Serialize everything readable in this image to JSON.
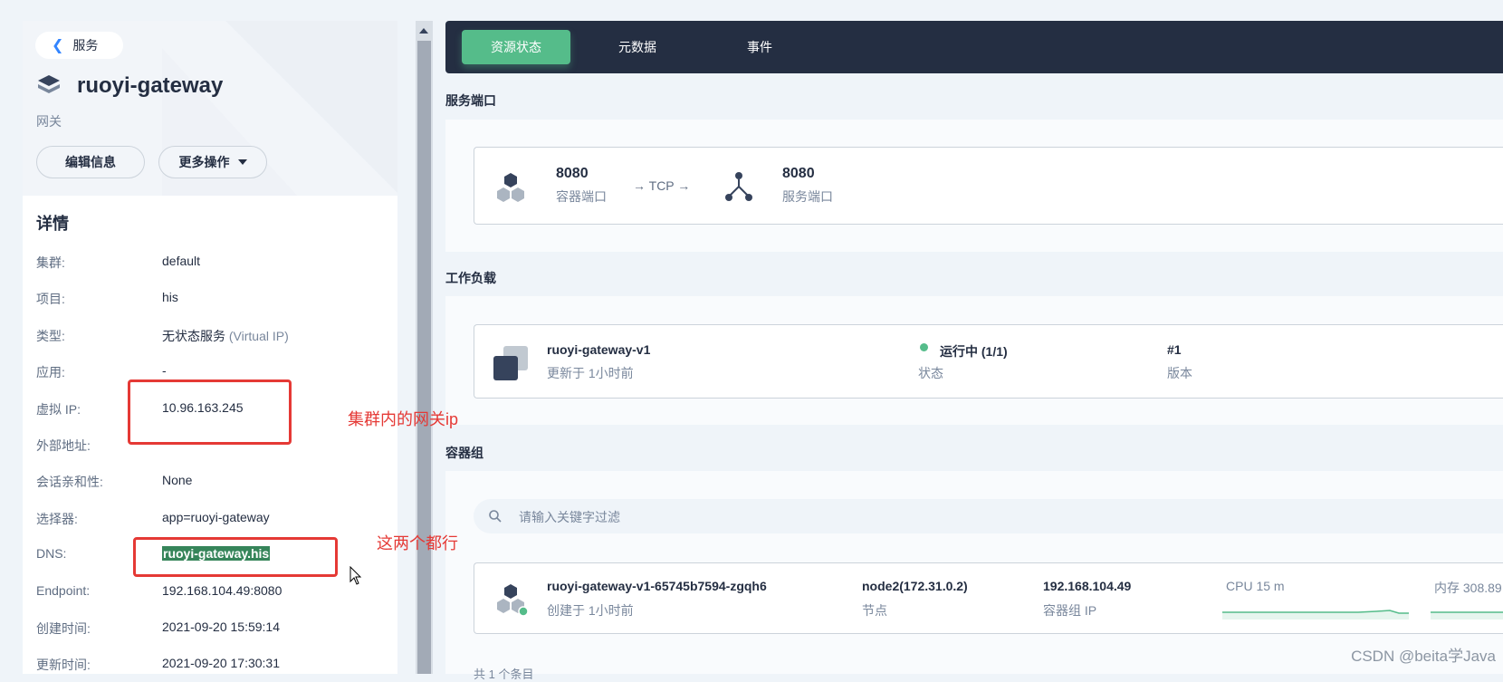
{
  "left": {
    "back_label": "服务",
    "service_name": "ruoyi-gateway",
    "service_alias": "网关",
    "edit_button": "编辑信息",
    "more_button": "更多操作",
    "details_title": "详情",
    "details": [
      {
        "key": "集群:",
        "value": "default",
        "extra": ""
      },
      {
        "key": "项目:",
        "value": "his",
        "extra": ""
      },
      {
        "key": "类型:",
        "value": "无状态服务",
        "extra": "(Virtual IP)"
      },
      {
        "key": "应用:",
        "value": "-",
        "extra": ""
      },
      {
        "key": "虚拟 IP:",
        "value": "10.96.163.245",
        "extra": ""
      },
      {
        "key": "外部地址:",
        "value": "",
        "extra": ""
      },
      {
        "key": "会话亲和性:",
        "value": "None",
        "extra": ""
      },
      {
        "key": "选择器:",
        "value": "app=ruoyi-gateway",
        "extra": ""
      },
      {
        "key": "DNS:",
        "value": "ruoyi-gateway.his",
        "extra": ""
      },
      {
        "key": "Endpoint:",
        "value": "192.168.104.49:8080",
        "extra": ""
      },
      {
        "key": "创建时间:",
        "value": "2021-09-20 15:59:14",
        "extra": ""
      },
      {
        "key": "更新时间:",
        "value": "2021-09-20 17:30:31",
        "extra": ""
      }
    ]
  },
  "tabs": [
    {
      "label": "资源状态",
      "active": true
    },
    {
      "label": "元数据",
      "active": false
    },
    {
      "label": "事件",
      "active": false
    }
  ],
  "ports": {
    "title": "服务端口",
    "container_port": "8080",
    "container_port_label": "容器端口",
    "protocol": "→ TCP →",
    "service_port": "8080",
    "service_port_label": "服务端口"
  },
  "workload": {
    "title": "工作负载",
    "name": "ruoyi-gateway-v1",
    "updated": "更新于 1小时前",
    "status": "运行中 (1/1)",
    "status_label": "状态",
    "version": "#1",
    "version_label": "版本"
  },
  "pods": {
    "title": "容器组",
    "search_placeholder": "请输入关键字过滤",
    "pod_name": "ruoyi-gateway-v1-65745b7594-zgqh6",
    "created": "创建于 1小时前",
    "node": "node2(172.31.0.2)",
    "node_label": "节点",
    "pod_ip": "192.168.104.49",
    "pod_ip_label": "容器组 IP",
    "cpu": "CPU 15 m",
    "memory": "内存 308.89",
    "footer": "共 1 个条目"
  },
  "annotations": {
    "ip_note": "集群内的网关ip",
    "dns_note": "这两个都行"
  },
  "watermark": "CSDN @beita学Java",
  "colors": {
    "accent_green": "#55bc8a",
    "dark_nav": "#242e42",
    "annotation_red": "#e53935",
    "dns_highlight": "#36855a"
  }
}
